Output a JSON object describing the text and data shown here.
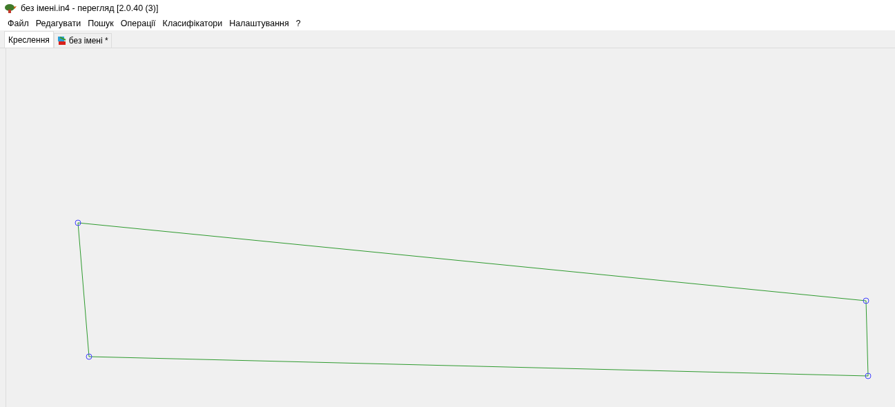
{
  "window": {
    "title": "без імені.in4 - перегляд [2.0.40 (3)]"
  },
  "menu": [
    "Файл",
    "Редагувати",
    "Пошук",
    "Операції",
    "Класифікатори",
    "Налаштування",
    "?"
  ],
  "tabs": [
    {
      "label": "Креслення",
      "selected": true,
      "kind": "plain"
    },
    {
      "label": "без імені *",
      "selected": false,
      "kind": "document"
    }
  ]
}
